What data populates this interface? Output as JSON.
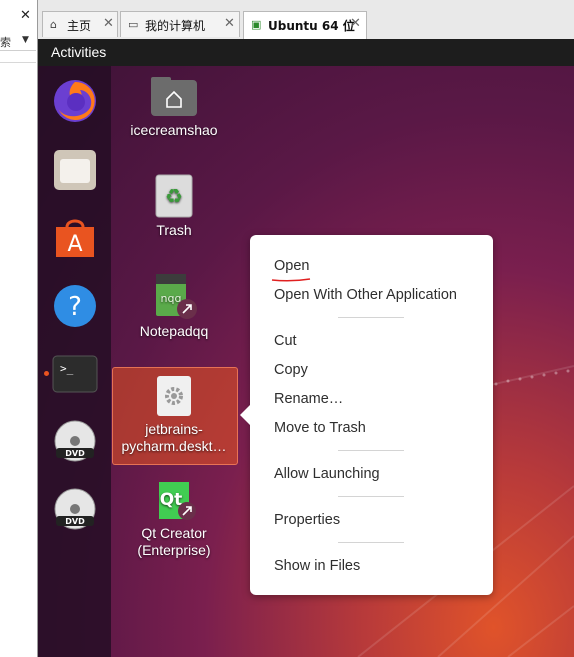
{
  "library": {
    "close": "✕",
    "search_text": "索"
  },
  "tabs": [
    {
      "label": "主页",
      "icon": "home-icon",
      "close": "✕"
    },
    {
      "label": "我的计算机",
      "icon": "computer-icon",
      "close": "✕"
    },
    {
      "label": "Ubuntu 64 位",
      "icon": "vm-icon",
      "close": "✕"
    }
  ],
  "topbar": {
    "activities": "Activities"
  },
  "desktop_icons": [
    {
      "label": "icecreamshao"
    },
    {
      "label": "Trash"
    },
    {
      "label": "Notepadqq"
    },
    {
      "label_line1": "jetbrains-",
      "label_line2": "pycharm.deskt…"
    },
    {
      "label_line1": "Qt Creator",
      "label_line2": "(Enterprise)"
    }
  ],
  "dock": [
    "firefox-icon",
    "files-icon",
    "software-icon",
    "help-icon",
    "terminal-icon",
    "dvd-icon",
    "dvd-icon"
  ],
  "context_menu": {
    "items": [
      "Open",
      "Open With Other Application",
      "Cut",
      "Copy",
      "Rename…",
      "Move to Trash",
      "Allow Launching",
      "Properties",
      "Show in Files"
    ]
  },
  "colors": {
    "accent": "#e95420",
    "topbar": "#1d1d1d",
    "annotation": "#e02020"
  }
}
